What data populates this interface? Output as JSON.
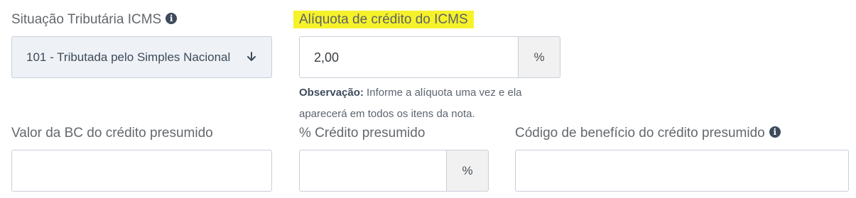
{
  "fields": {
    "situacao": {
      "label": "Situação Tributária ICMS",
      "value": "101 - Tributada pelo Simples Nacional"
    },
    "aliquota": {
      "label": "Alíquota de crédito do ICMS",
      "value": "2,00",
      "unit": "%",
      "note_title": "Observação:",
      "note_text": " Informe a alíquota uma vez e ela aparecerá em todos os itens da nota."
    },
    "valor_bc": {
      "label": "Valor da BC do crédito presumido",
      "value": ""
    },
    "credito_presumido": {
      "label": "% Crédito presumido",
      "value": "",
      "unit": "%"
    },
    "codigo_beneficio": {
      "label": "Código de benefício do crédito presumido",
      "value": ""
    }
  },
  "icons": {
    "info": "i",
    "select_arrow": "arrow-down-icon"
  },
  "colors": {
    "highlight": "#f6f22a",
    "select_bg": "#eef2f7",
    "addon_bg": "#f1f1f1",
    "border": "#c9cfd8"
  }
}
